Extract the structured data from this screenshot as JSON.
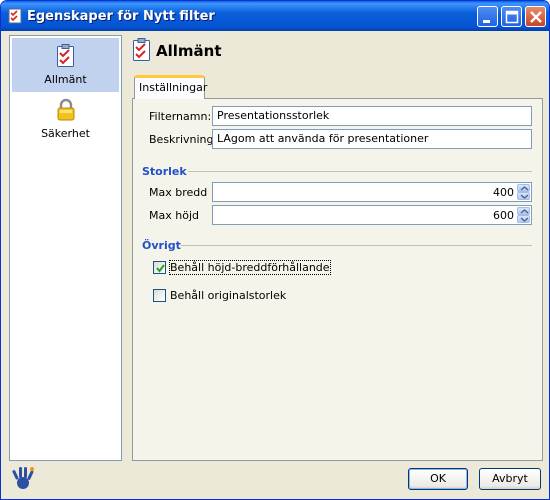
{
  "window": {
    "title": "Egenskaper för Nytt filter"
  },
  "sidebar": {
    "items": [
      {
        "label": "Allmänt",
        "icon": "checklist-icon",
        "selected": true
      },
      {
        "label": "Säkerhet",
        "icon": "lock-icon",
        "selected": false
      }
    ]
  },
  "header": {
    "title": "Allmänt"
  },
  "tabs": [
    {
      "label": "Inställningar"
    }
  ],
  "form": {
    "name_label": "Filternamn:",
    "name_value": "Presentationsstorlek",
    "desc_label": "Beskrivning:",
    "desc_value": "LAgom att använda för presentationer"
  },
  "size_section": {
    "title": "Storlek",
    "max_width_label": "Max bredd",
    "max_width_value": "400",
    "max_height_label": "Max höjd",
    "max_height_value": "600"
  },
  "other_section": {
    "title": "Övrigt",
    "keep_ratio_label": "Behåll höjd-breddförhållande",
    "keep_ratio_checked": true,
    "keep_original_label": "Behåll originalstorlek",
    "keep_original_checked": false
  },
  "buttons": {
    "ok": "OK",
    "cancel": "Avbryt"
  },
  "colors": {
    "titlebar": "#0a5fd8",
    "section": "#2150c8",
    "selection": "#c1d2ee",
    "tab_highlight": "#ffc83c"
  }
}
